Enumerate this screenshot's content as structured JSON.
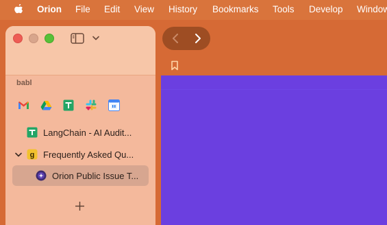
{
  "menubar": {
    "app_name": "Orion",
    "items": [
      "File",
      "Edit",
      "View",
      "History",
      "Bookmarks",
      "Tools",
      "Develop",
      "Window"
    ]
  },
  "sidebar": {
    "workspace_label": "babl",
    "favorites": [
      {
        "icon": "gmail-icon"
      },
      {
        "icon": "google-drive-icon"
      },
      {
        "icon": "google-sheets-icon"
      },
      {
        "icon": "slack-icon"
      },
      {
        "icon": "google-calendar-icon"
      }
    ],
    "tabs": [
      {
        "label": "LangChain - AI Audit...",
        "icon": "google-sheets-icon"
      },
      {
        "label": "Frequently Asked Qu...",
        "icon": "gitbook-icon"
      },
      {
        "label": "Orion Public Issue T...",
        "icon": "orion-icon",
        "selected": true
      }
    ]
  },
  "colors": {
    "accent_orange": "#d66a35",
    "content_purple": "#6b3fe0",
    "sidebar_bg": "#f4b99c"
  }
}
